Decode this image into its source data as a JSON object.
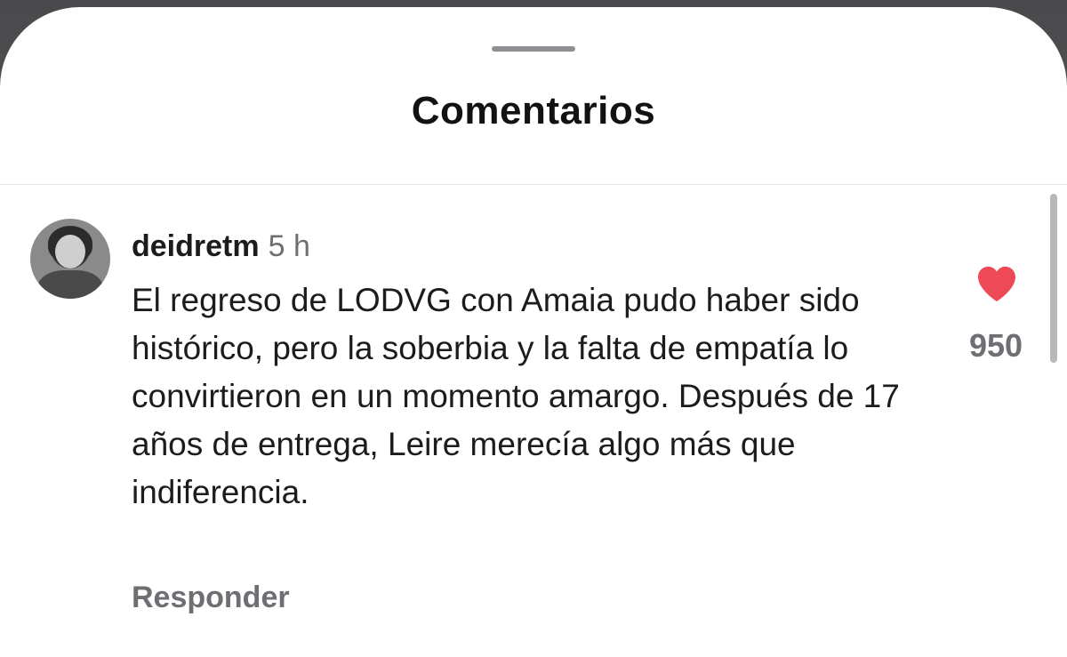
{
  "sheet": {
    "title": "Comentarios"
  },
  "comment": {
    "username": "deidretm",
    "timestamp": "5 h",
    "text": "El regreso de LODVG con Amaia pudo haber sido histórico, pero la soberbia y la falta de empatía lo convirtieron en un momento amargo. Después de 17 años de entrega, Leire merecía algo más que indiferencia.",
    "reply_label": "Responder",
    "like_icon": "heart-filled-icon",
    "like_count": "950"
  },
  "colors": {
    "like": "#ed4956",
    "secondary_text": "#6e6e73",
    "primary_text": "#1c1c1e"
  }
}
